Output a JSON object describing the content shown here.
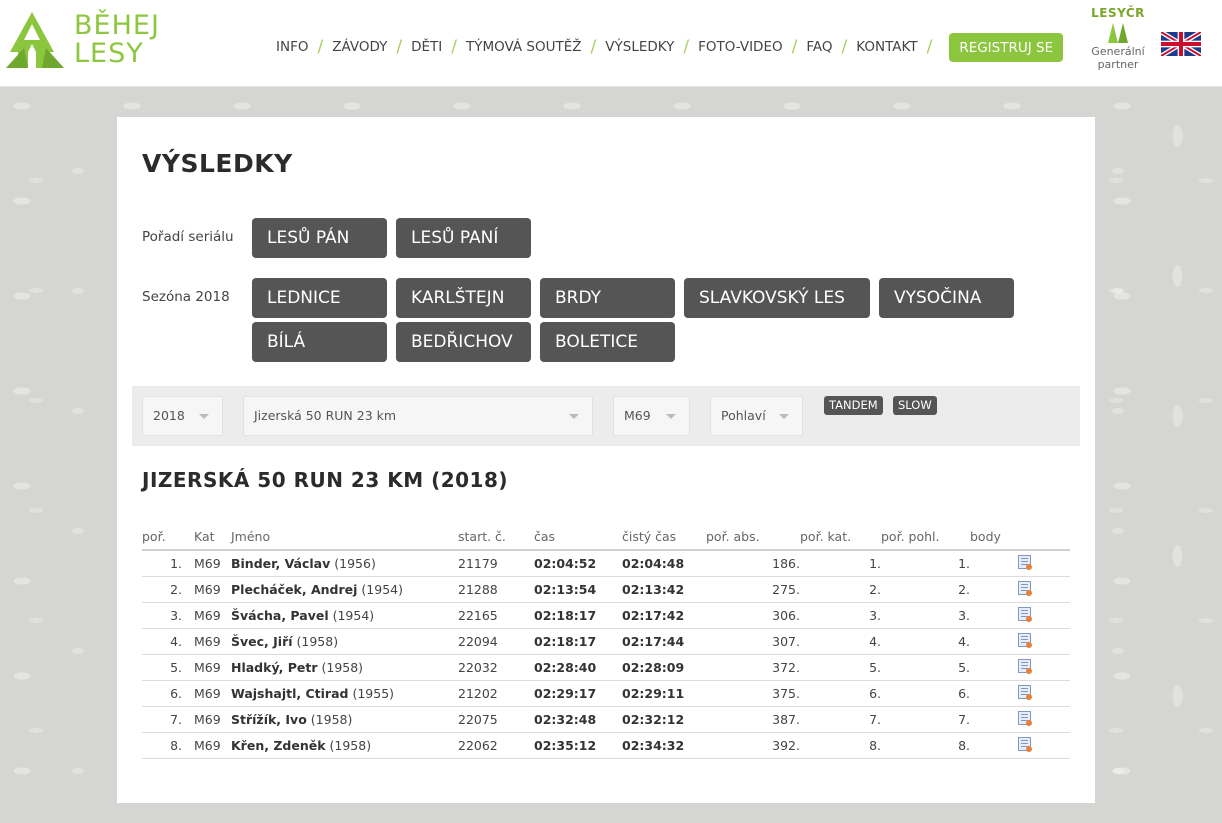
{
  "header": {
    "logo_line1": "BĚHEJ",
    "logo_line2": "LESY",
    "nav": [
      "INFO",
      "ZÁVODY",
      "DĚTI",
      "TÝMOVÁ SOUTĚŽ",
      "VÝSLEDKY",
      "FOTO-VIDEO",
      "FAQ",
      "KONTAKT"
    ],
    "register_label": "REGISTRUJ SE",
    "partner_name": "LESYČR",
    "partner_label_line1": "Generální",
    "partner_label_line2": "partner",
    "language_flag_icon": "uk-flag-icon"
  },
  "page": {
    "title": "VÝSLEDKY",
    "series_label": "Pořadí seriálu",
    "series_buttons": [
      "LESŮ PÁN",
      "LESŮ PANÍ"
    ],
    "season_label": "Sezóna 2018",
    "season_buttons": [
      "LEDNICE",
      "KARLŠTEJN",
      "BRDY",
      "SLAVKOVSKÝ LES",
      "VYSOČINA",
      "BÍLÁ",
      "BEDŘICHOV",
      "BOLETICE"
    ]
  },
  "filters": {
    "year": "2018",
    "race": "Jizerská 50 RUN 23 km",
    "category": "M69",
    "gender_placeholder": "Pohlaví",
    "tandem_label": "TANDEM",
    "slow_label": "SLOW"
  },
  "results": {
    "title": "JIZERSKÁ 50 RUN 23 KM (2018)",
    "columns": [
      "poř.",
      "Kat",
      "Jméno",
      "start. č.",
      "čas",
      "čistý čas",
      "poř. abs.",
      "poř. kat.",
      "poř. pohl.",
      "body"
    ],
    "rows": [
      {
        "pos": "1.",
        "cat": "M69",
        "name": "Binder, Václav",
        "year": "(1956)",
        "start": "21179",
        "time": "02:04:52",
        "net": "02:04:48",
        "abs": "186.",
        "kat": "1.",
        "pohl": "1."
      },
      {
        "pos": "2.",
        "cat": "M69",
        "name": "Plecháček, Andrej",
        "year": "(1954)",
        "start": "21288",
        "time": "02:13:54",
        "net": "02:13:42",
        "abs": "275.",
        "kat": "2.",
        "pohl": "2."
      },
      {
        "pos": "3.",
        "cat": "M69",
        "name": "Švácha, Pavel",
        "year": "(1954)",
        "start": "22165",
        "time": "02:18:17",
        "net": "02:17:42",
        "abs": "306.",
        "kat": "3.",
        "pohl": "3."
      },
      {
        "pos": "4.",
        "cat": "M69",
        "name": "Švec, Jiří",
        "year": "(1958)",
        "start": "22094",
        "time": "02:18:17",
        "net": "02:17:44",
        "abs": "307.",
        "kat": "4.",
        "pohl": "4."
      },
      {
        "pos": "5.",
        "cat": "M69",
        "name": "Hladký, Petr",
        "year": "(1958)",
        "start": "22032",
        "time": "02:28:40",
        "net": "02:28:09",
        "abs": "372.",
        "kat": "5.",
        "pohl": "5."
      },
      {
        "pos": "6.",
        "cat": "M69",
        "name": "Wajshajtl, Ctirad",
        "year": "(1955)",
        "start": "21202",
        "time": "02:29:17",
        "net": "02:29:11",
        "abs": "375.",
        "kat": "6.",
        "pohl": "6."
      },
      {
        "pos": "7.",
        "cat": "M69",
        "name": "Střížík, Ivo",
        "year": "(1958)",
        "start": "22075",
        "time": "02:32:48",
        "net": "02:32:12",
        "abs": "387.",
        "kat": "7.",
        "pohl": "7."
      },
      {
        "pos": "8.",
        "cat": "M69",
        "name": "Křen, Zdeněk",
        "year": "(1958)",
        "start": "22062",
        "time": "02:35:12",
        "net": "02:34:32",
        "abs": "392.",
        "kat": "8.",
        "pohl": "8."
      }
    ],
    "row_icon": "diploma-icon"
  },
  "colors": {
    "brand_green": "#8cc63f",
    "dark_button": "#555555",
    "background": "#d6d6d4"
  }
}
